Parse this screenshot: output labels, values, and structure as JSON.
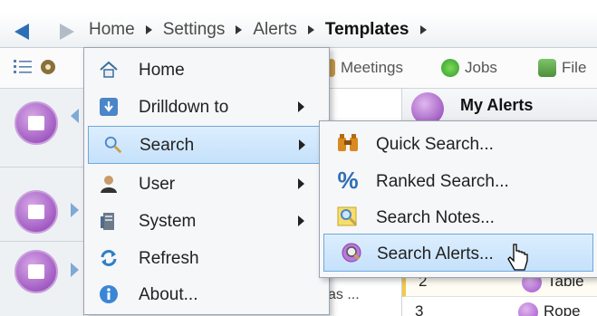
{
  "breadcrumb": {
    "items": [
      "Home",
      "Settings",
      "Alerts",
      "Templates"
    ]
  },
  "toolbar": {
    "meetings_label": "Meetings",
    "jobs_label": "Jobs",
    "file_label": "File"
  },
  "right_panel": {
    "title": "My Alerts",
    "rows": [
      {
        "num": "2",
        "name": "Table"
      },
      {
        "num": "3",
        "name": "Rope"
      }
    ],
    "partial_text": "as ..."
  },
  "menu": {
    "items": [
      {
        "label": "Home",
        "icon": "home-icon",
        "has_submenu": false
      },
      {
        "label": "Drilldown to",
        "icon": "download-icon",
        "has_submenu": true
      },
      {
        "label": "Search",
        "icon": "search-icon",
        "has_submenu": true
      },
      {
        "label": "User",
        "icon": "user-icon",
        "has_submenu": true
      },
      {
        "label": "System",
        "icon": "system-icon",
        "has_submenu": true
      },
      {
        "label": "Refresh",
        "icon": "refresh-icon",
        "has_submenu": false
      },
      {
        "label": "About...",
        "icon": "info-icon",
        "has_submenu": false
      }
    ]
  },
  "submenu": {
    "items": [
      {
        "label": "Quick Search...",
        "icon": "binoculars-icon"
      },
      {
        "label": "Ranked Search...",
        "icon": "percent-icon"
      },
      {
        "label": "Search Notes...",
        "icon": "notes-search-icon"
      },
      {
        "label": "Search Alerts...",
        "icon": "alerts-search-icon"
      }
    ]
  },
  "colors": {
    "highlight": "#c5e1fb",
    "highlight_border": "#6ea8dc",
    "accent_blue": "#2d6fb6"
  }
}
